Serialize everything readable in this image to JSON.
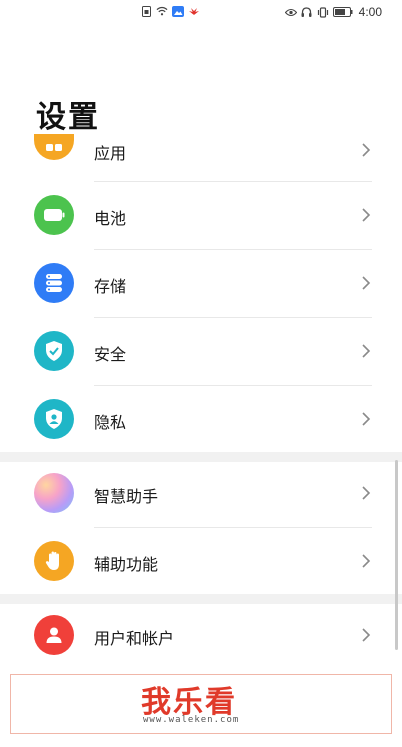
{
  "status_bar": {
    "time": "4:00",
    "left_icons": [
      "sim-icon",
      "wifi-icon",
      "image-icon",
      "huawei-icon"
    ],
    "right_icons": [
      "eye-icon",
      "headset-icon",
      "vibrate-icon",
      "battery-icon"
    ]
  },
  "page": {
    "title": "设置"
  },
  "settings": {
    "items": [
      {
        "label": "应用",
        "icon": "apps-icon",
        "color": "#f5a623"
      },
      {
        "label": "电池",
        "icon": "battery-setting-icon",
        "color": "#4cc34e"
      },
      {
        "label": "存储",
        "icon": "storage-icon",
        "color": "#2f7cf6"
      },
      {
        "label": "安全",
        "icon": "shield-check-icon",
        "color": "#1fb6c7"
      },
      {
        "label": "隐私",
        "icon": "privacy-icon",
        "color": "#1fb6c7"
      },
      {
        "label": "智慧助手",
        "icon": "assistant-icon",
        "color": "#c69cf5"
      },
      {
        "label": "辅助功能",
        "icon": "hand-icon",
        "color": "#f5a623"
      },
      {
        "label": "用户和帐户",
        "icon": "user-icon",
        "color": "#f0403a"
      }
    ]
  },
  "watermark": {
    "logo": "我乐看",
    "url": "www.waleken.com"
  }
}
